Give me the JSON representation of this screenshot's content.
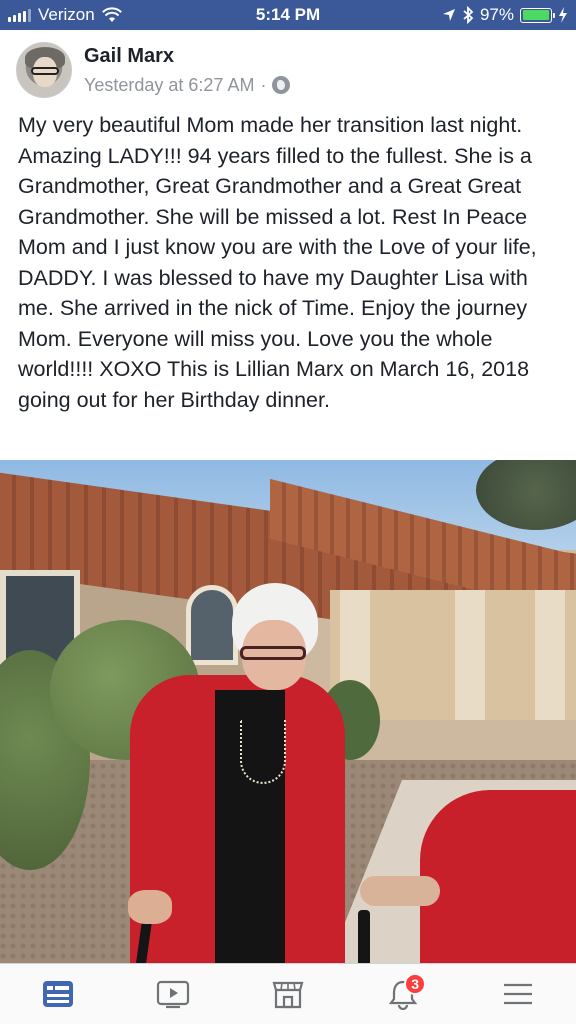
{
  "status_bar": {
    "carrier": "Verizon",
    "time": "5:14 PM",
    "battery_percent": "97%",
    "battery_level": 0.97,
    "icons": [
      "signal-icon",
      "wifi-icon",
      "location-arrow-icon",
      "bluetooth-icon",
      "battery-icon",
      "charging-bolt-icon"
    ]
  },
  "post": {
    "author": "Gail Marx",
    "timestamp": "Yesterday at 6:27 AM",
    "separator": "·",
    "privacy_icon": "globe-icon",
    "text": "My very beautiful Mom made her transition last night.  Amazing LADY!!!  94 years filled to the fullest.  She is a Grandmother, Great Grandmother and a Great Great Grandmother.   She will be missed a lot.  Rest In Peace Mom and I just know you are with the Love of your life, DADDY.   I was blessed to have my Daughter Lisa with me.  She arrived in the nick of Time.  Enjoy the journey Mom.  Everyone will miss you.  Love you the whole world!!!!  XOXO   This is Lillian Marx on March 16, 2018 going out for her Birthday dinner."
  },
  "tab_bar": {
    "tabs": [
      {
        "icon": "news-feed-icon",
        "active": true
      },
      {
        "icon": "watch-video-icon",
        "active": false
      },
      {
        "icon": "marketplace-icon",
        "active": false
      },
      {
        "icon": "notifications-bell-icon",
        "active": false,
        "badge": "3"
      },
      {
        "icon": "menu-icon",
        "active": false
      }
    ],
    "active_color": "#4267b2",
    "inactive_color": "#6f7376"
  },
  "colors": {
    "status_bar_bg": "#3b5998",
    "text": "#1d2129",
    "secondary_text": "#90949c",
    "badge": "#fa3e3e"
  }
}
